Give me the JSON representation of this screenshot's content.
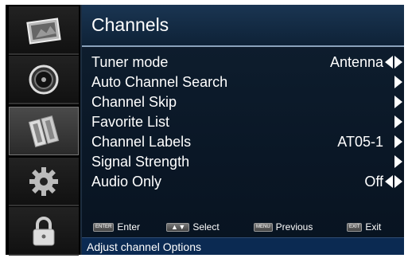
{
  "header": {
    "title": "Channels"
  },
  "sidebar": {
    "items": [
      {
        "icon": "picture-icon"
      },
      {
        "icon": "sound-icon"
      },
      {
        "icon": "channel-icon",
        "selected": true
      },
      {
        "icon": "gear-icon"
      },
      {
        "icon": "lock-icon"
      }
    ]
  },
  "menu": {
    "items": [
      {
        "label": "Tuner mode",
        "value": "Antenna",
        "arrows": "left-right"
      },
      {
        "label": "Auto Channel Search",
        "value": "",
        "arrows": "right"
      },
      {
        "label": "Channel Skip",
        "value": "",
        "arrows": "right"
      },
      {
        "label": "Favorite List",
        "value": "",
        "arrows": "right"
      },
      {
        "label": "Channel Labels",
        "value": "AT05-1",
        "arrows": "right"
      },
      {
        "label": "Signal Strength",
        "value": "",
        "arrows": "right"
      },
      {
        "label": "Audio Only",
        "value": "Off",
        "arrows": "left-right"
      }
    ]
  },
  "hints": {
    "enter_key": "ENTER",
    "enter_label": "Enter",
    "select_key": "▲ ▼",
    "select_label": "Select",
    "menu_key": "MENU",
    "menu_label": "Previous",
    "exit_key": "EXIT",
    "exit_label": "Exit"
  },
  "status": {
    "text": "Adjust channel Options"
  },
  "colors": {
    "accent": "#0b2a52",
    "panel": "#0f1f30"
  }
}
